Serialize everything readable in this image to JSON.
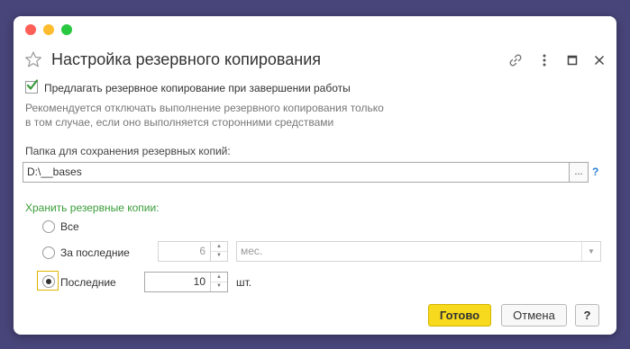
{
  "dialog": {
    "title": "Настройка резервного копирования",
    "offer_backup_label": "Предлагать резервное копирование при завершении работы",
    "offer_backup_checked": true,
    "hint_lines": [
      "Рекомендуется отключать выполнение резервного копирования только",
      "в том случае, если оно выполняется сторонними средствами"
    ],
    "folder_label": "Папка для сохранения резервных копий:",
    "folder_value": "D:\\__bases",
    "browse_label": "...",
    "help_q": "?",
    "keep_label": "Хранить резервные копии:",
    "options": {
      "all": "Все",
      "last_period": "За последние",
      "last_count": "Последние"
    },
    "selected_option": "last_count",
    "period_value": "6",
    "period_unit": "мес.",
    "count_value": "10",
    "count_unit": "шт."
  },
  "buttons": {
    "ok": "Готово",
    "cancel": "Отмена",
    "help": "?"
  },
  "colors": {
    "background": "#48457a",
    "accent_yellow": "#f7d91e",
    "group_label_green": "#3a9d3a",
    "help_blue": "#2a7fd4",
    "check_green": "#3b9a3b"
  },
  "icons": {
    "favorite": "star-icon",
    "link": "link-icon",
    "more": "more-icon",
    "maximize": "maximize-icon",
    "close": "close-icon"
  }
}
